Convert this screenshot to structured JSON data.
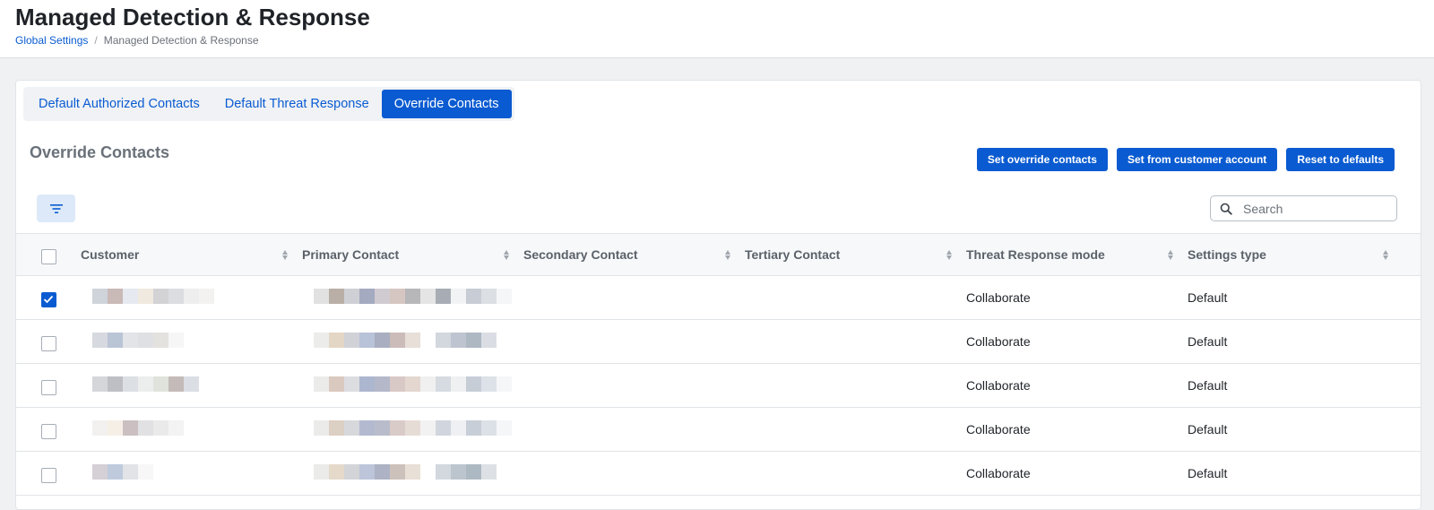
{
  "header": {
    "title": "Managed Detection & Response",
    "breadcrumb": [
      {
        "label": "Global Settings",
        "link": true
      },
      {
        "label": "Managed Detection & Response",
        "link": false
      }
    ]
  },
  "tabs": [
    {
      "label": "Default Authorized Contacts",
      "active": false
    },
    {
      "label": "Default Threat Response",
      "active": false
    },
    {
      "label": "Override Contacts",
      "active": true
    }
  ],
  "section_title": "Override Contacts",
  "actions": {
    "set_override": "Set override contacts",
    "set_from_account": "Set from customer account",
    "reset_defaults": "Reset to defaults"
  },
  "search": {
    "placeholder": "Search",
    "value": ""
  },
  "icons": {
    "filter": "filter-icon",
    "search": "search-icon",
    "sort": "sort-icon",
    "check": "check-icon"
  },
  "colors": {
    "accent": "#0a5bd1",
    "filter_bg": "#dde9f8"
  },
  "table": {
    "columns": [
      "Customer",
      "Primary Contact",
      "Secondary Contact",
      "Tertiary Contact",
      "Threat Response mode",
      "Settings type"
    ],
    "rows": [
      {
        "checked": true,
        "customer": "[redacted]",
        "primary": "[redacted]",
        "secondary": "",
        "tertiary": "",
        "mode": "Collaborate",
        "settings_type": "Default"
      },
      {
        "checked": false,
        "customer": "[redacted]",
        "primary": "[redacted]",
        "secondary": "",
        "tertiary": "",
        "mode": "Collaborate",
        "settings_type": "Default"
      },
      {
        "checked": false,
        "customer": "[redacted]",
        "primary": "[redacted]",
        "secondary": "",
        "tertiary": "",
        "mode": "Collaborate",
        "settings_type": "Default"
      },
      {
        "checked": false,
        "customer": "[redacted]",
        "primary": "[redacted]",
        "secondary": "",
        "tertiary": "",
        "mode": "Collaborate",
        "settings_type": "Default"
      },
      {
        "checked": false,
        "customer": "[redacted]",
        "primary": "[redacted]",
        "secondary": "",
        "tertiary": "",
        "mode": "Collaborate",
        "settings_type": "Default"
      }
    ]
  }
}
